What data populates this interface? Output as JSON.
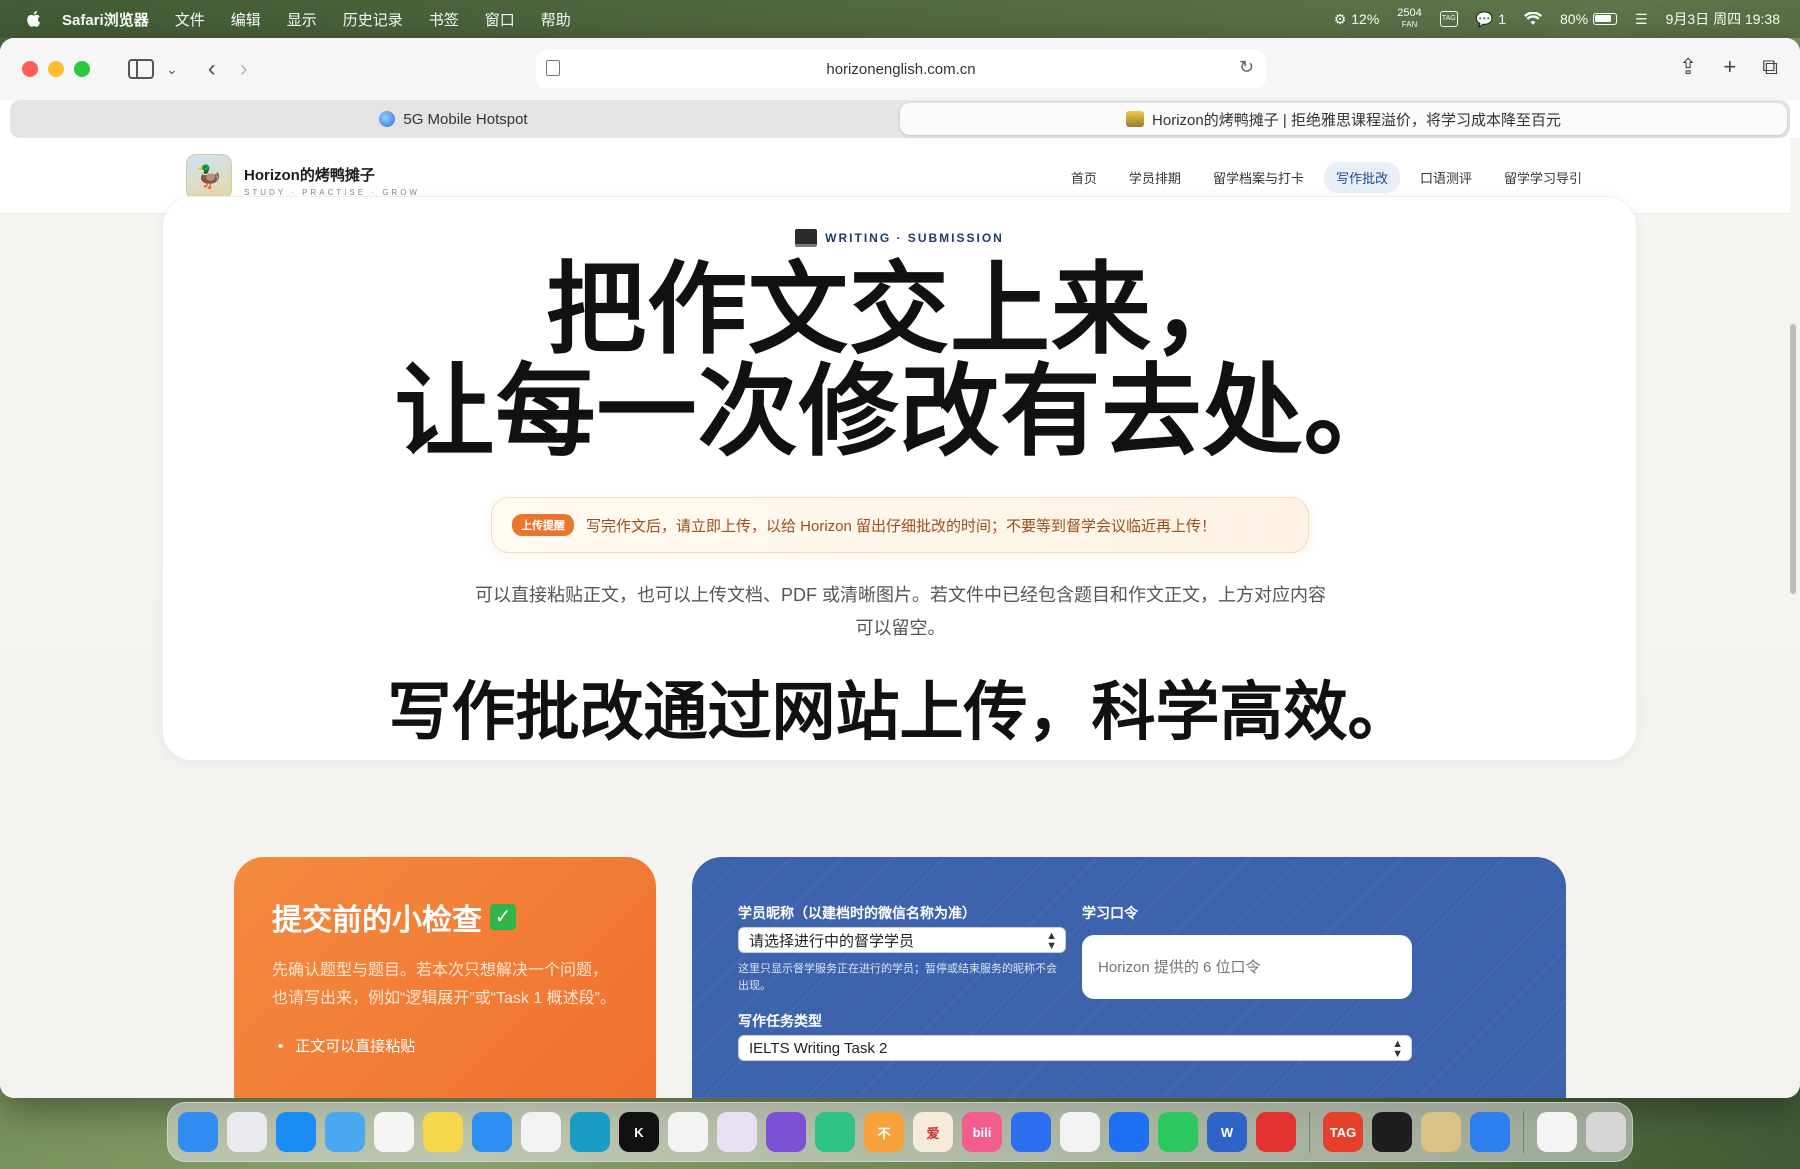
{
  "menubar": {
    "app_name": "Safari浏览器",
    "items": [
      "文件",
      "编辑",
      "显示",
      "历史记录",
      "书签",
      "窗口",
      "帮助"
    ],
    "status": {
      "cpu": "12%",
      "fan_value": "2504",
      "fan_label": "FAN",
      "tag_icon_text": "TAG",
      "wechat_count": "1",
      "battery": "80%",
      "datetime": "9月3日 周四 19:38"
    }
  },
  "browser": {
    "url": "horizonenglish.com.cn",
    "tabs": [
      {
        "label": "5G Mobile Hotspot",
        "active": false
      },
      {
        "label": "Horizon的烤鸭摊子 | 拒绝雅思课程溢价，将学习成本降至百元",
        "active": true
      }
    ]
  },
  "site": {
    "brand_name": "Horizon的烤鸭摊子",
    "brand_tagline": "STUDY · PRACTISE · GROW",
    "nav": [
      {
        "label": "首页",
        "active": false
      },
      {
        "label": "学员排期",
        "active": false
      },
      {
        "label": "留学档案与打卡",
        "active": false
      },
      {
        "label": "写作批改",
        "active": true
      },
      {
        "label": "口语测评",
        "active": false
      },
      {
        "label": "留学学习导引",
        "active": false
      }
    ]
  },
  "hero": {
    "eyebrow": "WRITING · SUBMISSION",
    "title_line1": "把作文交上来，",
    "title_line2": "让每一次修改有去处。",
    "reminder_badge": "上传提醒",
    "reminder_text": "写完作文后，请立即上传，以给 Horizon 留出仔细批改的时间；不要等到督学会议临近再上传！",
    "description": "可以直接粘贴正文，也可以上传文档、PDF 或清晰图片。若文件中已经包含题目和作文正文，上方对应内容可以留空。",
    "caption": "写作批改通过网站上传，科学高效。"
  },
  "checklist": {
    "title": "提交前的小检查",
    "check_glyph": "✓",
    "description": "先确认题型与题目。若本次只想解决一个问题，也请写出来，例如“逻辑展开”或“Task 1 概述段”。",
    "items": [
      "正文可以直接粘贴"
    ]
  },
  "form": {
    "student_label": "学员昵称（以建档时的微信名称为准）",
    "student_select_value": "请选择进行中的督学学员",
    "student_hint": "这里只显示督学服务正在进行的学员；暂停或结束服务的昵称不会出现。",
    "passcode_label": "学习口令",
    "passcode_placeholder": "Horizon 提供的 6 位口令",
    "task_label": "写作任务类型",
    "task_select_value": "IELTS Writing Task 2"
  },
  "dock": {
    "icons": [
      {
        "name": "finder-icon",
        "color": "#2f8cf0",
        "text": ""
      },
      {
        "name": "launchpad-icon",
        "color": "#e9e9ee",
        "text": ""
      },
      {
        "name": "app-store-icon",
        "color": "#1a8cf5",
        "text": ""
      },
      {
        "name": "icloud-icon",
        "color": "#4aa8f0",
        "text": ""
      },
      {
        "name": "photos-icon",
        "color": "#f5f5f5",
        "text": ""
      },
      {
        "name": "notes-icon",
        "color": "#f6d64a",
        "text": ""
      },
      {
        "name": "safari-icon",
        "color": "#2d8ff2",
        "text": ""
      },
      {
        "name": "chrome-icon",
        "color": "#f2f2f2",
        "text": ""
      },
      {
        "name": "edge-icon",
        "color": "#1b9cc7",
        "text": ""
      },
      {
        "name": "k-app-icon",
        "color": "#111111",
        "text": "K"
      },
      {
        "name": "chatgpt-icon",
        "color": "#f3f3f3",
        "text": ""
      },
      {
        "name": "avatar-app-icon",
        "color": "#e8e0f2",
        "text": ""
      },
      {
        "name": "ai-assistant-icon",
        "color": "#7b4fd6",
        "text": ""
      },
      {
        "name": "list-app-icon",
        "color": "#2fc38a",
        "text": ""
      },
      {
        "name": "not-forget-icon",
        "color": "#f7a23a",
        "text": "不"
      },
      {
        "name": "aitingxie-icon",
        "color": "#f6eadb",
        "text": "爱"
      },
      {
        "name": "bilibili-icon",
        "color": "#f25d8e",
        "text": "bili"
      },
      {
        "name": "qq-browser-icon",
        "color": "#2e6ff2",
        "text": ""
      },
      {
        "name": "photo-app-icon",
        "color": "#f2f2f2",
        "text": ""
      },
      {
        "name": "lark-icon",
        "color": "#1f6ff2",
        "text": ""
      },
      {
        "name": "wechat-icon",
        "color": "#2dc760",
        "text": ""
      },
      {
        "name": "word-icon",
        "color": "#2e64c8",
        "text": "W"
      },
      {
        "name": "netease-music-icon",
        "color": "#e23232",
        "text": ""
      },
      {
        "name": "tag-app-icon",
        "color": "#e5402b",
        "text": "TAG"
      },
      {
        "name": "activity-monitor-icon",
        "color": "#1e1e1e",
        "text": ""
      },
      {
        "name": "horizon-app-icon",
        "color": "#d9c387",
        "text": ""
      },
      {
        "name": "mail-app-icon",
        "color": "#2d7ff0",
        "text": ""
      },
      {
        "name": "document-icon",
        "color": "#f4f4f4",
        "text": ""
      },
      {
        "name": "trash-icon",
        "color": "#d6d6d6",
        "text": ""
      }
    ]
  }
}
